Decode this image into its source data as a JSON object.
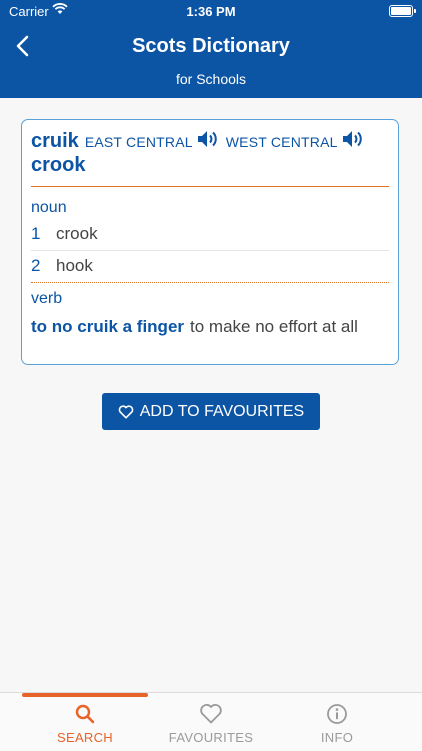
{
  "status_bar": {
    "carrier": "Carrier",
    "time": "1:36 PM"
  },
  "header": {
    "title": "Scots Dictionary",
    "subtitle": "for Schools"
  },
  "entry": {
    "headword": "cruik",
    "regions": [
      "EAST CENTRAL",
      "WEST CENTRAL"
    ],
    "english": "crook",
    "pos_noun": "noun",
    "senses": [
      {
        "num": "1",
        "gloss": "crook"
      },
      {
        "num": "2",
        "gloss": "hook"
      }
    ],
    "pos_verb": "verb",
    "phrase": "to no cruik a finger",
    "phrase_meaning": "to make no effort at all"
  },
  "favourite_button": {
    "label": "ADD TO FAVOURITES"
  },
  "tabs": [
    {
      "label": "SEARCH",
      "icon": "search-icon",
      "active": true
    },
    {
      "label": "FAVOURITES",
      "icon": "heart-icon",
      "active": false
    },
    {
      "label": "INFO",
      "icon": "info-icon",
      "active": false
    }
  ],
  "colors": {
    "brand_blue": "#0c54a4",
    "accent_orange": "#e8632a",
    "card_border": "#5aa3d9"
  }
}
